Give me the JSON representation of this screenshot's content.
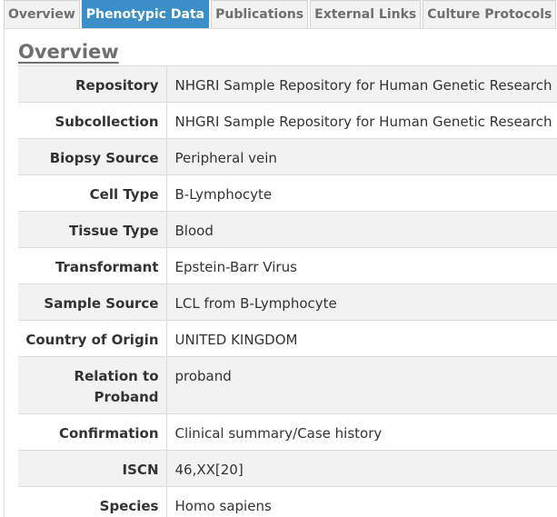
{
  "tabs": [
    {
      "label": "Overview",
      "active": false
    },
    {
      "label": "Phenotypic Data",
      "active": true
    },
    {
      "label": "Publications",
      "active": false
    },
    {
      "label": "External Links",
      "active": false
    },
    {
      "label": "Culture Protocols",
      "active": false
    }
  ],
  "section": {
    "title": "Overview"
  },
  "rows": [
    {
      "key": "Repository",
      "value": "NHGRI Sample Repository for Human Genetic Research"
    },
    {
      "key": "Subcollection",
      "value": "NHGRI Sample Repository for Human Genetic Research"
    },
    {
      "key": "Biopsy Source",
      "value": "Peripheral vein"
    },
    {
      "key": "Cell Type",
      "value": "B-Lymphocyte"
    },
    {
      "key": "Tissue Type",
      "value": "Blood"
    },
    {
      "key": "Transformant",
      "value": "Epstein-Barr Virus"
    },
    {
      "key": "Sample Source",
      "value": "LCL from B-Lymphocyte"
    },
    {
      "key": "Country of Origin",
      "value": "UNITED KINGDOM"
    },
    {
      "key": "Relation to Proband",
      "value": "proband"
    },
    {
      "key": "Confirmation",
      "value": "Clinical summary/Case history"
    },
    {
      "key": "ISCN",
      "value": "46,XX[20]"
    },
    {
      "key": "Species",
      "value": "Homo sapiens"
    }
  ],
  "colors": {
    "active_tab": "#3b8fc9",
    "inactive_tab": "#f2f2f2",
    "stripe": "#f2f2f2"
  }
}
